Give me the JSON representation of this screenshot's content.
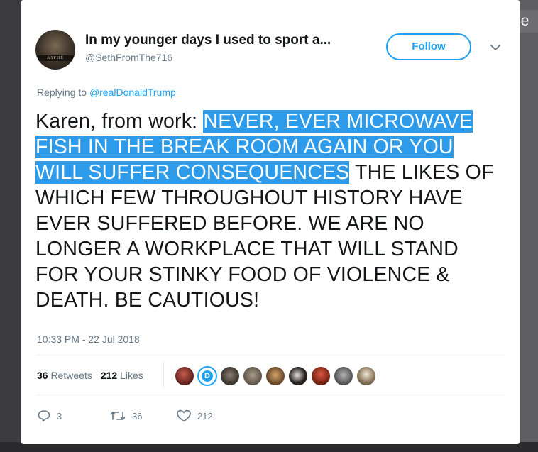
{
  "overlay": {
    "handle_fragment": "@Se"
  },
  "tweet": {
    "display_name": "In my younger days I used to sport a...",
    "username": "@SethFromThe716",
    "follow_label": "Follow",
    "replying_prefix": "Replying to",
    "replying_to": "@realDonaldTrump",
    "text_plain_lead": "Karen, from work: ",
    "text_highlighted": "NEVER, EVER MICROWAVE FISH IN THE BREAK ROOM AGAIN OR YOU WILL SUFFER CONSEQUENCES",
    "text_plain_tail": " THE LIKES OF WHICH FEW THROUGHOUT HISTORY HAVE EVER SUFFERED BEFORE. WE ARE NO LONGER A WORKPLACE THAT WILL STAND FOR YOUR STINKY FOOD OF VIOLENCE & DEATH. BE CAUTIOUS!",
    "timestamp": "10:33 PM - 22 Jul 2018",
    "retweets_count": "36",
    "retweets_label": "Retweets",
    "likes_count": "212",
    "likes_label": "Likes",
    "likers": [
      "avatar-1",
      "avatar-2",
      "avatar-3",
      "avatar-4",
      "avatar-5",
      "avatar-6",
      "avatar-7",
      "avatar-8",
      "avatar-9"
    ],
    "actions": {
      "reply_count": "3",
      "retweet_count": "36",
      "like_count": "212"
    }
  },
  "colors": {
    "accent": "#1da1f2",
    "highlight": "#2e9bea",
    "text": "#14171a",
    "muted": "#657786"
  },
  "icons": {
    "reply": "reply-icon",
    "retweet": "retweet-icon",
    "like": "heart-icon",
    "menu": "chevron-down-icon"
  }
}
